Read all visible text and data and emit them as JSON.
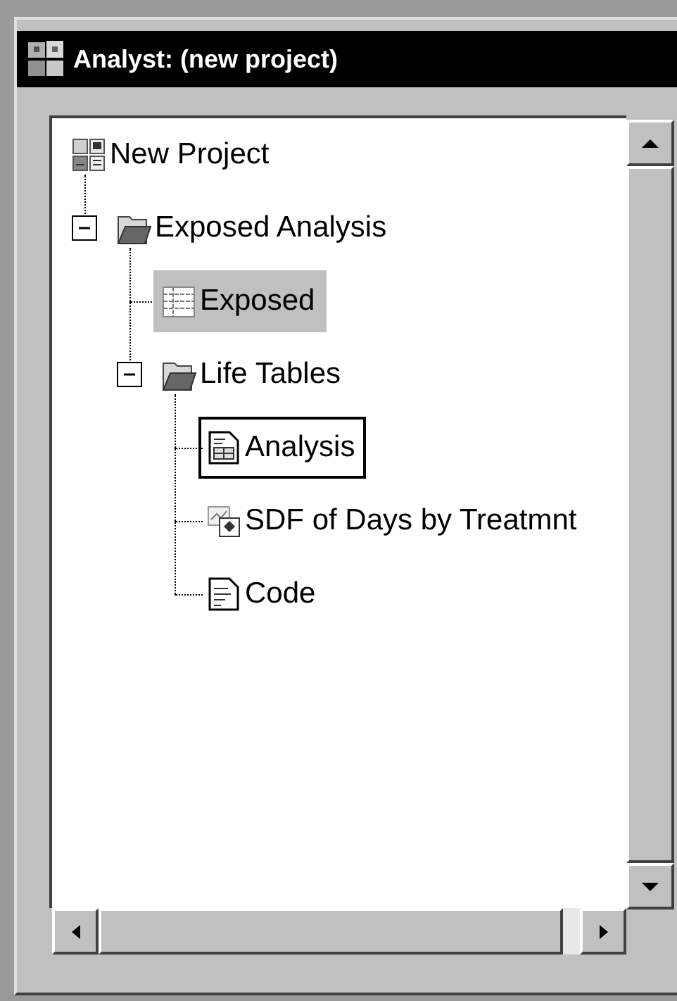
{
  "window": {
    "title": "Analyst: (new project)"
  },
  "tree": [
    {
      "label": "New Project",
      "kind": "project",
      "selected": false,
      "focused": false,
      "children": [
        {
          "label": "Exposed Analysis",
          "kind": "folder",
          "selected": false,
          "focused": false,
          "expanded": true,
          "children": [
            {
              "label": "Exposed",
              "kind": "table",
              "selected": true,
              "focused": false
            },
            {
              "label": "Life Tables",
              "kind": "folder",
              "selected": false,
              "focused": false,
              "expanded": true,
              "children": [
                {
                  "label": "Analysis",
                  "kind": "report",
                  "selected": false,
                  "focused": true
                },
                {
                  "label": "SDF of Days by Treatmnt",
                  "kind": "graph",
                  "selected": false,
                  "focused": false
                },
                {
                  "label": "Code",
                  "kind": "code",
                  "selected": false,
                  "focused": false
                }
              ]
            }
          ]
        }
      ]
    }
  ]
}
